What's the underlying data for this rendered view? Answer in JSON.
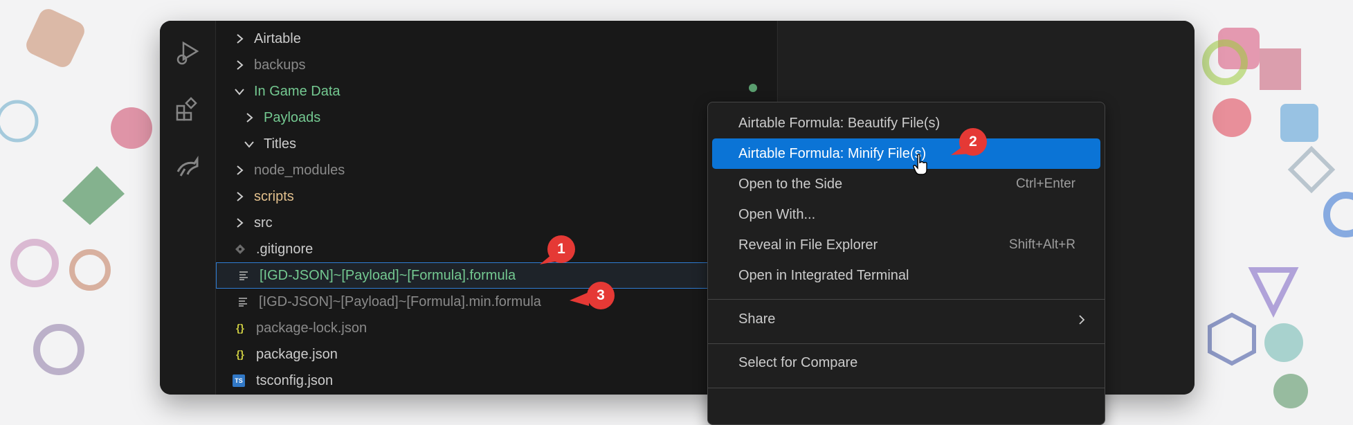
{
  "explorer": {
    "items": [
      {
        "label": "Airtable",
        "kind": "folder",
        "expanded": false,
        "color": "#cccccc"
      },
      {
        "label": "backups",
        "kind": "folder",
        "expanded": false,
        "color": "#8a8a8a"
      },
      {
        "label": "In Game Data",
        "kind": "folder",
        "expanded": true,
        "color": "#74c991"
      },
      {
        "label": "Payloads",
        "kind": "folder",
        "expanded": false,
        "color": "#74c991"
      },
      {
        "label": "Titles",
        "kind": "folder",
        "expanded": true,
        "color": "#cccccc"
      },
      {
        "label": "node_modules",
        "kind": "folder",
        "expanded": false,
        "color": "#8a8a8a"
      },
      {
        "label": "scripts",
        "kind": "folder",
        "expanded": false,
        "color": "#e2c08d"
      },
      {
        "label": "src",
        "kind": "folder",
        "expanded": false,
        "color": "#cccccc"
      },
      {
        "label": ".gitignore",
        "kind": "file",
        "icon": "git-icon",
        "color": "#cccccc"
      },
      {
        "label": "[IGD-JSON]~[Payload]~[Formula].formula",
        "kind": "file",
        "icon": "lines-icon",
        "color": "#74c991"
      },
      {
        "label": "[IGD-JSON]~[Payload]~[Formula].min.formula",
        "kind": "file",
        "icon": "lines-icon",
        "color": "#8a8a8a"
      },
      {
        "label": "package-lock.json",
        "kind": "file",
        "icon": "json-icon",
        "color": "#8a8a8a"
      },
      {
        "label": "package.json",
        "kind": "file",
        "icon": "json-icon",
        "color": "#cccccc"
      },
      {
        "label": "tsconfig.json",
        "kind": "file",
        "icon": "ts-icon",
        "color": "#cccccc"
      }
    ]
  },
  "icons": {
    "json_glyph": "{}",
    "ts_glyph": "TS"
  },
  "context_menu": {
    "items": [
      {
        "label": "Airtable Formula: Beautify File(s)",
        "shortcut": ""
      },
      {
        "label": "Airtable Formula: Minify File(s)",
        "shortcut": "",
        "active": true
      },
      {
        "label": "Open to the Side",
        "shortcut": "Ctrl+Enter"
      },
      {
        "label": "Open With...",
        "shortcut": ""
      },
      {
        "label": "Reveal in File Explorer",
        "shortcut": "Shift+Alt+R"
      },
      {
        "label": "Open in Integrated Terminal",
        "shortcut": ""
      },
      {
        "label": "Share",
        "shortcut": "",
        "submenu": true
      },
      {
        "label": "Select for Compare",
        "shortcut": ""
      }
    ]
  },
  "badges": [
    "1",
    "2",
    "3"
  ],
  "colors": {
    "accent": "#0b74d6",
    "badge": "#e53935",
    "selection_border": "#2f7dd4",
    "git_added": "#74c991"
  }
}
